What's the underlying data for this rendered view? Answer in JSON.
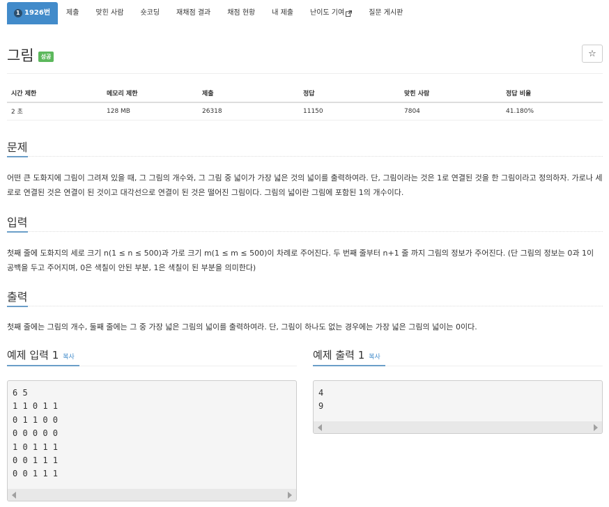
{
  "nav": {
    "problem_number": "1926번",
    "tabs": [
      "제출",
      "맞힌 사람",
      "숏코딩",
      "재채점 결과",
      "채점 현황",
      "내 제출",
      "난이도 기여",
      "질문 게시판"
    ]
  },
  "problem": {
    "title": "그림",
    "status_label": "성공",
    "star": "☆"
  },
  "info": {
    "headers": [
      "시간 제한",
      "메모리 제한",
      "제출",
      "정답",
      "맞힌 사람",
      "정답 비율"
    ],
    "values": [
      "2 초",
      "128 MB",
      "26318",
      "11150",
      "7804",
      "41.180%"
    ]
  },
  "sections": {
    "problem_heading": "문제",
    "problem_text": "어떤 큰 도화지에 그림이 그려져 있을 때, 그 그림의 개수와, 그 그림 중 넓이가 가장 넓은 것의 넓이를 출력하여라. 단, 그림이라는 것은 1로 연결된 것을 한 그림이라고 정의하자. 가로나 세로로 연결된 것은 연결이 된 것이고 대각선으로 연결이 된 것은 떨어진 그림이다. 그림의 넓이란 그림에 포함된 1의 개수이다.",
    "input_heading": "입력",
    "input_text": "첫째 줄에 도화지의 세로 크기 n(1 ≤ n ≤ 500)과 가로 크기 m(1 ≤ m ≤ 500)이 차례로 주어진다. 두 번째 줄부터 n+1 줄 까지 그림의 정보가 주어진다. (단 그림의 정보는 0과 1이 공백을 두고 주어지며, 0은 색칠이 안된 부분, 1은 색칠이 된 부분을 의미한다)",
    "output_heading": "출력",
    "output_text": "첫째 줄에는 그림의 개수, 둘째 줄에는 그 중 가장 넓은 그림의 넓이를 출력하여라. 단, 그림이 하나도 없는 경우에는 가장 넓은 그림의 넓이는 0이다."
  },
  "samples": {
    "input_heading": "예제 입력 1",
    "output_heading": "예제 출력 1",
    "copy_label": "복사",
    "input": "6 5\n1 1 0 1 1\n0 1 1 0 0\n0 0 0 0 0\n1 0 1 1 1\n0 0 1 1 1\n0 0 1 1 1",
    "output": "4\n9"
  },
  "colors": {
    "active_tab": "#428bca",
    "success": "#5cb85c",
    "link": "#428bca"
  }
}
